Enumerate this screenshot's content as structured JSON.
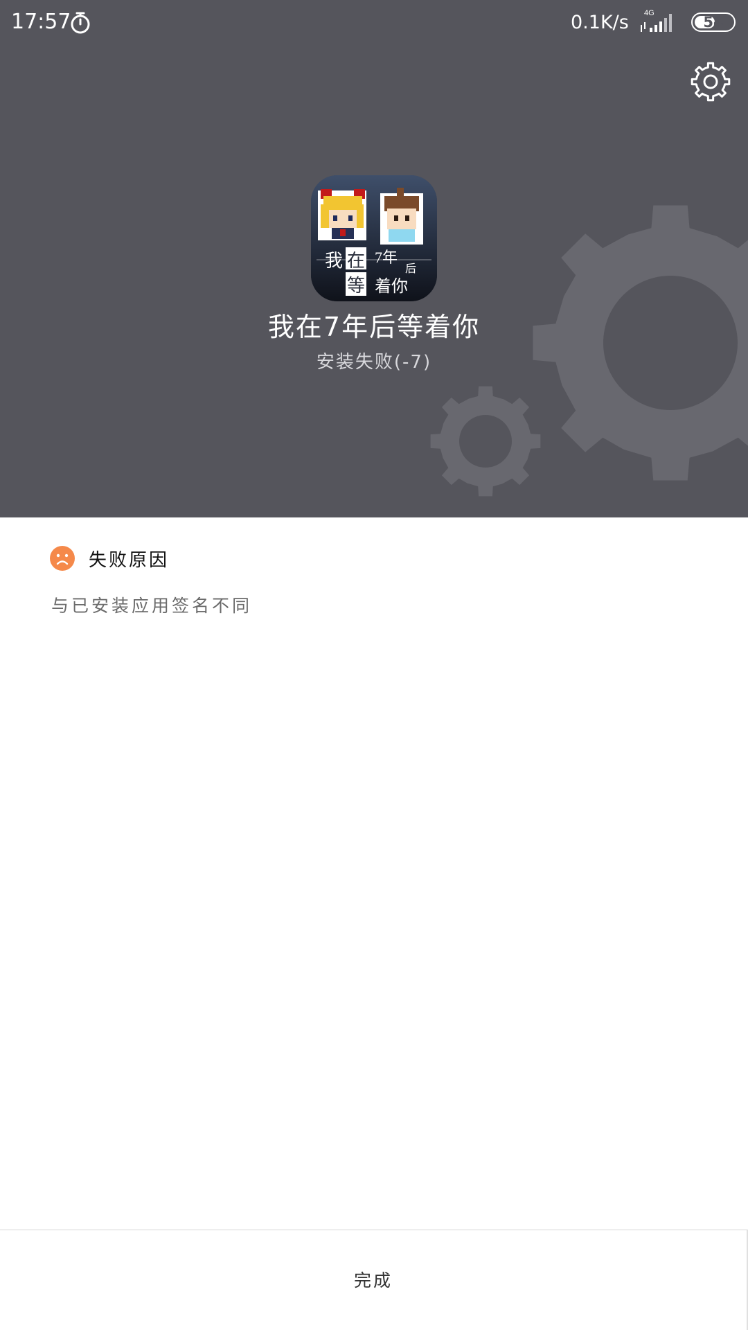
{
  "status_bar": {
    "time": "17:57",
    "network_speed": "0.1K/s",
    "network_type": "4G",
    "battery": "54",
    "battery_level": 0.54
  },
  "header": {
    "app_name": "我在7年后等着你",
    "install_status": "安装失败(-7)",
    "icon_text": [
      "我",
      "在",
      "7年",
      "后",
      "等",
      "着你"
    ]
  },
  "failure": {
    "title": "失败原因",
    "reason": "与已安装应用签名不同"
  },
  "footer": {
    "done_label": "完成"
  },
  "colors": {
    "header_bg": "#55555c",
    "gear": "#68686f",
    "sad_icon": "#f5894a"
  },
  "icons": {
    "timer": "stopwatch-icon",
    "settings": "gear-icon",
    "reason": "sad-face-icon"
  }
}
